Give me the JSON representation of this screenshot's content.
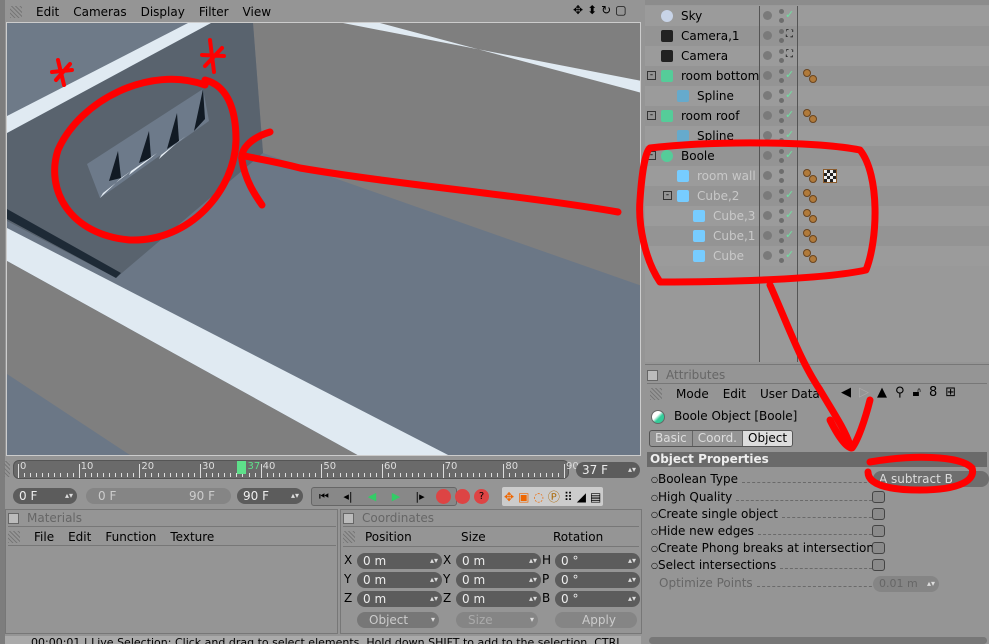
{
  "viewport": {
    "menu": [
      "Edit",
      "Cameras",
      "Display",
      "Filter",
      "View"
    ],
    "nav_icons": [
      "move-icon",
      "zoom-icon",
      "rotate-icon",
      "maximize-icon"
    ]
  },
  "outliner": {
    "items": [
      {
        "name": "Sky",
        "icon": "sky-icon",
        "level": 0,
        "dim": false,
        "status": "check",
        "tags": []
      },
      {
        "name": "Camera,1",
        "icon": "camera-icon",
        "level": 0,
        "dim": false,
        "status": "target",
        "tags": []
      },
      {
        "name": "Camera",
        "icon": "camera-icon",
        "level": 0,
        "dim": false,
        "status": "target",
        "tags": []
      },
      {
        "name": "room bottom",
        "icon": "extrude-icon",
        "level": 0,
        "dim": false,
        "status": "check",
        "tags": [
          "phong"
        ],
        "expanded": true
      },
      {
        "name": "Spline",
        "icon": "spline-icon",
        "level": 1,
        "dim": false,
        "status": "check",
        "tags": []
      },
      {
        "name": "room roof",
        "icon": "extrude-icon",
        "level": 0,
        "dim": false,
        "status": "check",
        "tags": [
          "phong"
        ],
        "expanded": true
      },
      {
        "name": "Spline",
        "icon": "spline-icon",
        "level": 1,
        "dim": false,
        "status": "check",
        "tags": []
      },
      {
        "name": "Boole",
        "icon": "boole-icon",
        "level": 0,
        "dim": false,
        "status": "check",
        "tags": [],
        "expanded": true
      },
      {
        "name": "room wall",
        "icon": "polygon-icon",
        "level": 1,
        "dim": true,
        "status": "none",
        "tags": [
          "phong",
          "texture"
        ]
      },
      {
        "name": "Cube,2",
        "icon": "cube-icon",
        "level": 1,
        "dim": true,
        "status": "check",
        "tags": [
          "phong"
        ],
        "expanded": true
      },
      {
        "name": "Cube,3",
        "icon": "cube-icon",
        "level": 2,
        "dim": true,
        "status": "check",
        "tags": [
          "phong"
        ]
      },
      {
        "name": "Cube,1",
        "icon": "cube-icon",
        "level": 2,
        "dim": true,
        "status": "check",
        "tags": [
          "phong"
        ]
      },
      {
        "name": "Cube",
        "icon": "cube-icon",
        "level": 2,
        "dim": true,
        "status": "check",
        "tags": [
          "phong"
        ]
      }
    ]
  },
  "attributes": {
    "title": "Attributes",
    "menu": [
      "Mode",
      "Edit",
      "User Data"
    ],
    "object_title": "Boole Object [Boole]",
    "tabs": [
      "Basic",
      "Coord.",
      "Object"
    ],
    "active_tab": "Object",
    "section": "Object Properties",
    "boolean_type_label": "Boolean Type",
    "boolean_type_value": "A subtract B",
    "checkboxes": [
      {
        "label": "High Quality",
        "checked": true
      },
      {
        "label": "Create single object",
        "checked": false
      },
      {
        "label": "Hide new edges",
        "checked": false
      },
      {
        "label": "Create Phong breaks at intersections",
        "checked": false
      },
      {
        "label": "Select intersections",
        "checked": false
      }
    ],
    "optimize_label": "Optimize Points",
    "optimize_value": "0.01 m"
  },
  "timeline": {
    "ticks": [
      "0",
      "10",
      "20",
      "30",
      "40",
      "50",
      "60",
      "70",
      "80",
      "90"
    ],
    "current": "37",
    "current_field": "37 F",
    "start": "0 F",
    "range_start": "0 F",
    "range_end": "90 F",
    "end": "90 F"
  },
  "materials": {
    "title": "Materials",
    "menu": [
      "File",
      "Edit",
      "Function",
      "Texture"
    ]
  },
  "coordinates": {
    "title": "Coordinates",
    "headers": [
      "Position",
      "Size",
      "Rotation"
    ],
    "rows": [
      {
        "p_axis": "X",
        "p": "0 m",
        "s_axis": "X",
        "s": "0 m",
        "r_axis": "H",
        "r": "0 °"
      },
      {
        "p_axis": "Y",
        "p": "0 m",
        "s_axis": "Y",
        "s": "0 m",
        "r_axis": "P",
        "r": "0 °"
      },
      {
        "p_axis": "Z",
        "p": "0 m",
        "s_axis": "Z",
        "s": "0 m",
        "r_axis": "B",
        "r": "0 °"
      }
    ],
    "mode": "Object",
    "size_mode": "Size",
    "apply": "Apply"
  },
  "status": {
    "time": "00:00:01",
    "message": "Live Selection: Click and drag to select elements. Hold down SHIFT to add to the selection, CTRL"
  },
  "colors": {
    "annotation": "#ff0000",
    "panel": "#959595",
    "timeline_marker": "#5ee08a"
  }
}
